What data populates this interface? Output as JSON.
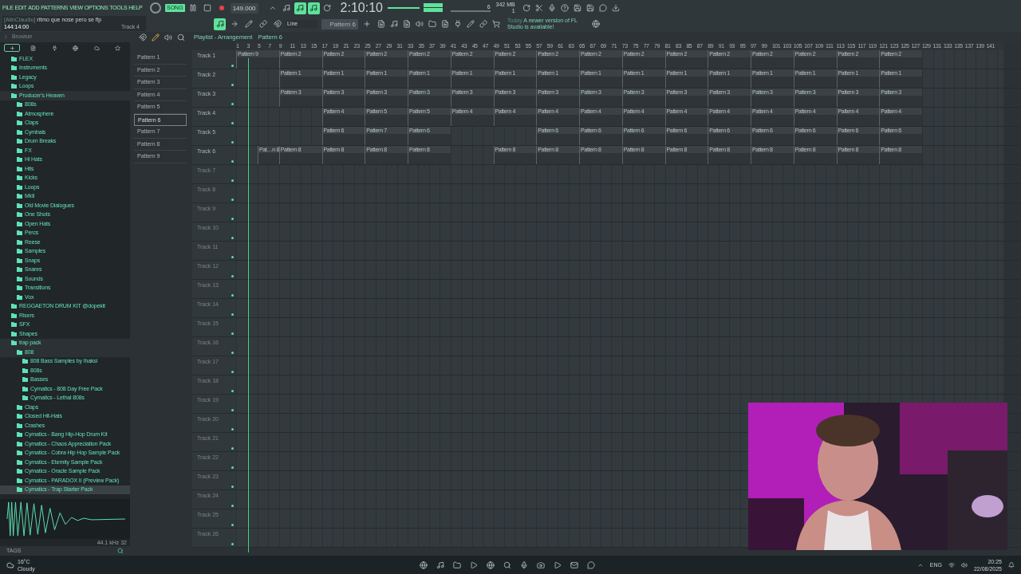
{
  "menu": [
    "FILE",
    "EDIT",
    "ADD",
    "PATTERNS",
    "VIEW",
    "OPTIONS",
    "TOOLS",
    "HELP"
  ],
  "transport": {
    "mode": "SONG",
    "song_mode": true,
    "tempo": "149.000",
    "time": "2:10:10"
  },
  "toggles": [
    {
      "on": false
    },
    {
      "on": false
    },
    {
      "on": true
    },
    {
      "on": true
    },
    {
      "on": false
    }
  ],
  "hint": {
    "user": "[AlinClaudiu]",
    "text": "ritmo que nose pero se flp",
    "position": "144:14:00",
    "track": "Track 4"
  },
  "cpu": "6",
  "memory": "342 MB",
  "poly": "1",
  "snap": "Line",
  "pattern_selector": "Pattern 6",
  "news": {
    "when": "Today",
    "text": "A newer version of FL Studio is available!"
  },
  "browser": {
    "title": "Browser",
    "tabs": [
      {
        "selected": true
      },
      {
        "selected": false
      },
      {
        "selected": false
      },
      {
        "selected": false
      },
      {
        "selected": false
      },
      {
        "selected": false
      }
    ],
    "tree": [
      {
        "label": "FLEX",
        "selected": false
      },
      {
        "label": "Instruments",
        "selected": false
      },
      {
        "label": "Legacy",
        "selected": false
      },
      {
        "label": "Loops",
        "selected": false
      },
      {
        "label": "Producer's Heaven",
        "selected": false,
        "children": [
          {
            "label": "808s",
            "selected": false
          },
          {
            "label": "Atmosphere",
            "selected": false
          },
          {
            "label": "Claps",
            "selected": false
          },
          {
            "label": "Cymbals",
            "selected": false
          },
          {
            "label": "Drum Breaks",
            "selected": false
          },
          {
            "label": "FX",
            "selected": false
          },
          {
            "label": "Hi Hats",
            "selected": false
          },
          {
            "label": "Hits",
            "selected": false
          },
          {
            "label": "Kicks",
            "selected": false
          },
          {
            "label": "Loops",
            "selected": false
          },
          {
            "label": "Midi",
            "selected": false
          },
          {
            "label": "Old Movie Dialogues",
            "selected": false
          },
          {
            "label": "One Shots",
            "selected": false
          },
          {
            "label": "Open Hats",
            "selected": false
          },
          {
            "label": "Percs",
            "selected": false
          },
          {
            "label": "Reese",
            "selected": false
          },
          {
            "label": "Samples",
            "selected": false
          },
          {
            "label": "Snaps",
            "selected": false
          },
          {
            "label": "Snares",
            "selected": false
          },
          {
            "label": "Sounds",
            "selected": false
          },
          {
            "label": "Transitions",
            "selected": false
          },
          {
            "label": "Vox",
            "selected": false
          }
        ]
      },
      {
        "label": "REGGAETON DRUM KIT @dopekit",
        "selected": false
      },
      {
        "label": "Risers",
        "selected": false
      },
      {
        "label": "SFX",
        "selected": false
      },
      {
        "label": "Shapes",
        "selected": false
      },
      {
        "label": "trap pack",
        "selected": false,
        "children": [
          {
            "label": "808",
            "selected": false,
            "children": [
              {
                "label": "808 Bass Samples by Ihaksi",
                "selected": false
              },
              {
                "label": "808s",
                "selected": false
              },
              {
                "label": "Basses",
                "selected": false
              },
              {
                "label": "Cymatics - 808 Day Free Pack",
                "selected": false
              },
              {
                "label": "Cymatics - Lethal 808s",
                "selected": false
              }
            ]
          },
          {
            "label": "Claps",
            "selected": false
          },
          {
            "label": "Closed Hit-Hats",
            "selected": false
          },
          {
            "label": "Crashes",
            "selected": false
          },
          {
            "label": "Cymatics - Bang Hip-Hop Drum Kit",
            "selected": false
          },
          {
            "label": "Cymatics - Chaos Appreciation Pack",
            "selected": false
          },
          {
            "label": "Cymatics - Cobra Hip Hop Sample Pack",
            "selected": false
          },
          {
            "label": "Cymatics - Eternity Sample Pack",
            "selected": false
          },
          {
            "label": "Cymatics - Oracle Sample Pack",
            "selected": false
          },
          {
            "label": "Cymatics - PARADOX II (Preview Pack)",
            "selected": false
          },
          {
            "label": "Cymatics - Trap Starter Pack",
            "selected": true
          }
        ]
      }
    ]
  },
  "sample": {
    "info": "44.1 kHz 32"
  },
  "tags": "TAGS",
  "playlist": {
    "title": "Playlist - Arrangement",
    "pattern": "Pattern 6",
    "patterns": [
      {
        "label": "Pattern 1",
        "selected": false
      },
      {
        "label": "Pattern 2",
        "selected": false
      },
      {
        "label": "Pattern 3",
        "selected": false
      },
      {
        "label": "Pattern 4",
        "selected": false
      },
      {
        "label": "Pattern 5",
        "selected": false
      },
      {
        "label": "Pattern 6",
        "selected": true
      },
      {
        "label": "Pattern 7",
        "selected": false
      },
      {
        "label": "Pattern 8",
        "selected": false
      },
      {
        "label": "Pattern 9",
        "selected": false
      }
    ],
    "ruler": [
      "1",
      "3",
      "5",
      "7",
      "9",
      "11",
      "13",
      "15",
      "17",
      "19",
      "21",
      "23",
      "25",
      "27",
      "29",
      "31",
      "33",
      "35",
      "37",
      "39",
      "41",
      "43",
      "45",
      "47",
      "49",
      "51",
      "53",
      "55",
      "57",
      "59",
      "61",
      "63",
      "65",
      "67",
      "69",
      "71",
      "73",
      "75",
      "77",
      "79",
      "81",
      "83",
      "85",
      "87",
      "89",
      "91",
      "93",
      "95",
      "97",
      "99",
      "101",
      "103",
      "105",
      "107",
      "109",
      "111",
      "113",
      "115",
      "117",
      "119",
      "121",
      "123",
      "125",
      "127",
      "129",
      "131",
      "133",
      "135",
      "137",
      "139",
      "141"
    ],
    "tracks": [
      {
        "name": "Track 1",
        "clips": [
          {
            "kind": "full",
            "label": "Pattern 9"
          },
          {
            "kind": "full",
            "label": "Pattern 2"
          },
          {
            "kind": "full",
            "label": "Pattern 2"
          },
          {
            "kind": "full",
            "label": "Pattern 2"
          },
          {
            "kind": "full",
            "label": "Pattern 2"
          },
          {
            "kind": "full",
            "label": "Pattern 2"
          },
          {
            "kind": "full",
            "label": "Pattern 2"
          },
          {
            "kind": "full",
            "label": "Pattern 2"
          },
          {
            "kind": "full",
            "label": "Pattern 2"
          },
          {
            "kind": "full",
            "label": "Pattern 2"
          },
          {
            "kind": "full",
            "label": "Pattern 2"
          },
          {
            "kind": "full",
            "label": "Pattern 2"
          },
          {
            "kind": "full",
            "label": "Pattern 2"
          },
          {
            "kind": "full",
            "label": "Pattern 2"
          },
          {
            "kind": "full",
            "label": "Pattern 2"
          },
          {
            "kind": "full",
            "label": "Pattern 2"
          }
        ]
      },
      {
        "name": "Track 2",
        "clips": [
          {
            "kind": "empty"
          },
          {
            "kind": "full",
            "label": "Pattern 1"
          },
          {
            "kind": "full",
            "label": "Pattern 1"
          },
          {
            "kind": "full",
            "label": "Pattern 1"
          },
          {
            "kind": "full",
            "label": "Pattern 1"
          },
          {
            "kind": "full",
            "label": "Pattern 1"
          },
          {
            "kind": "full",
            "label": "Pattern 1"
          },
          {
            "kind": "full",
            "label": "Pattern 1"
          },
          {
            "kind": "full",
            "label": "Pattern 1"
          },
          {
            "kind": "full",
            "label": "Pattern 1"
          },
          {
            "kind": "full",
            "label": "Pattern 1"
          },
          {
            "kind": "full",
            "label": "Pattern 1"
          },
          {
            "kind": "full",
            "label": "Pattern 1"
          },
          {
            "kind": "full",
            "label": "Pattern 1"
          },
          {
            "kind": "full",
            "label": "Pattern 1"
          },
          {
            "kind": "full",
            "label": "Pattern 1"
          }
        ]
      },
      {
        "name": "Track 3",
        "clips": [
          {
            "kind": "empty"
          },
          {
            "kind": "full",
            "label": "Pattern 3"
          },
          {
            "kind": "full",
            "label": "Pattern 3"
          },
          {
            "kind": "full",
            "label": "Pattern 3"
          },
          {
            "kind": "full",
            "label": "Pattern 3"
          },
          {
            "kind": "full",
            "label": "Pattern 3"
          },
          {
            "kind": "full",
            "label": "Pattern 3"
          },
          {
            "kind": "full",
            "label": "Pattern 3"
          },
          {
            "kind": "full",
            "label": "Pattern 3"
          },
          {
            "kind": "full",
            "label": "Pattern 3"
          },
          {
            "kind": "full",
            "label": "Pattern 3"
          },
          {
            "kind": "full",
            "label": "Pattern 3"
          },
          {
            "kind": "full",
            "label": "Pattern 3"
          },
          {
            "kind": "full",
            "label": "Pattern 3"
          },
          {
            "kind": "full",
            "label": "Pattern 3"
          },
          {
            "kind": "full",
            "label": "Pattern 3"
          }
        ]
      },
      {
        "name": "Track 4",
        "clips": [
          {
            "kind": "empty"
          },
          {
            "kind": "empty"
          },
          {
            "kind": "full",
            "label": "Pattern 4"
          },
          {
            "kind": "full",
            "label": "Pattern 5"
          },
          {
            "kind": "full",
            "label": "Pattern 5"
          },
          {
            "kind": "full",
            "label": "Pattern 4"
          },
          {
            "kind": "full",
            "label": "Pattern 4"
          },
          {
            "kind": "full",
            "label": "Pattern 4"
          },
          {
            "kind": "full",
            "label": "Pattern 4"
          },
          {
            "kind": "full",
            "label": "Pattern 4"
          },
          {
            "kind": "full",
            "label": "Pattern 4"
          },
          {
            "kind": "full",
            "label": "Pattern 4"
          },
          {
            "kind": "full",
            "label": "Pattern 4"
          },
          {
            "kind": "full",
            "label": "Pattern 4"
          },
          {
            "kind": "full",
            "label": "Pattern 4"
          },
          {
            "kind": "full",
            "label": "Pattern 4"
          }
        ]
      },
      {
        "name": "Track 5",
        "clips": [
          {
            "kind": "empty"
          },
          {
            "kind": "empty"
          },
          {
            "kind": "full",
            "label": "Pattern 6"
          },
          {
            "kind": "full",
            "label": "Pattern 7"
          },
          {
            "kind": "full",
            "label": "Pattern 6"
          },
          {
            "kind": "empty"
          },
          {
            "kind": "empty"
          },
          {
            "kind": "full",
            "label": "Pattern 6"
          },
          {
            "kind": "full",
            "label": "Pattern 6"
          },
          {
            "kind": "full",
            "label": "Pattern 6"
          },
          {
            "kind": "full",
            "label": "Pattern 6"
          },
          {
            "kind": "full",
            "label": "Pattern 6"
          },
          {
            "kind": "full",
            "label": "Pattern 6"
          },
          {
            "kind": "full",
            "label": "Pattern 6"
          },
          {
            "kind": "full",
            "label": "Pattern 6"
          },
          {
            "kind": "full",
            "label": "Pattern 6"
          }
        ]
      },
      {
        "name": "Track 6",
        "clips": [
          {
            "kind": "gap_half"
          },
          {
            "kind": "half",
            "label": "Pat…n 8"
          },
          {
            "kind": "full",
            "label": "Pattern 8"
          },
          {
            "kind": "full",
            "label": "Pattern 8"
          },
          {
            "kind": "full",
            "label": "Pattern 8"
          },
          {
            "kind": "full",
            "label": "Pattern 8"
          },
          {
            "kind": "empty"
          },
          {
            "kind": "full",
            "label": "Pattern 8"
          },
          {
            "kind": "full",
            "label": "Pattern 8"
          },
          {
            "kind": "full",
            "label": "Pattern 8"
          },
          {
            "kind": "full",
            "label": "Pattern 8"
          },
          {
            "kind": "full",
            "label": "Pattern 8"
          },
          {
            "kind": "full",
            "label": "Pattern 8"
          },
          {
            "kind": "full",
            "label": "Pattern 8"
          },
          {
            "kind": "full",
            "label": "Pattern 8"
          },
          {
            "kind": "full",
            "label": "Pattern 8"
          },
          {
            "kind": "full",
            "label": "Pattern 8"
          }
        ]
      },
      {
        "name": "Track 7"
      },
      {
        "name": "Track 8"
      },
      {
        "name": "Track 9"
      },
      {
        "name": "Track 10"
      },
      {
        "name": "Track 11"
      },
      {
        "name": "Track 12"
      },
      {
        "name": "Track 13"
      },
      {
        "name": "Track 14"
      },
      {
        "name": "Track 15"
      },
      {
        "name": "Track 16"
      },
      {
        "name": "Track 17"
      },
      {
        "name": "Track 18"
      },
      {
        "name": "Track 19"
      },
      {
        "name": "Track 20"
      },
      {
        "name": "Track 21"
      },
      {
        "name": "Track 22"
      },
      {
        "name": "Track 23"
      },
      {
        "name": "Track 24"
      },
      {
        "name": "Track 25"
      },
      {
        "name": "Track 26"
      }
    ]
  },
  "webcam": {
    "kind": "picture"
  },
  "taskbar": {
    "temperature": "16°C",
    "weather": "Cloudy",
    "language": "ENG",
    "time": "20:25",
    "date": "22/08/2025"
  }
}
